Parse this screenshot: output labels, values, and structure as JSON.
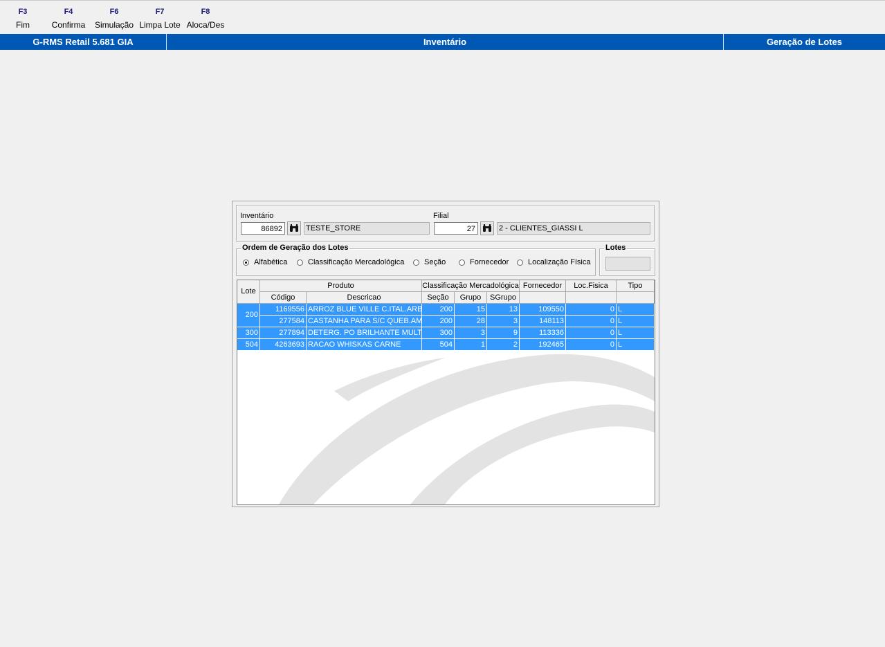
{
  "toolbar": [
    {
      "key": "F3",
      "label": "Fim"
    },
    {
      "key": "F4",
      "label": "Confirma"
    },
    {
      "key": "F6",
      "label": "Simulação"
    },
    {
      "key": "F7",
      "label": "Limpa Lote"
    },
    {
      "key": "F8",
      "label": "Aloca/Des"
    }
  ],
  "titlebar": {
    "app": "G-RMS Retail 5.681 GIA",
    "module": "Inventário",
    "screen": "Geração de Lotes"
  },
  "filters": {
    "inventario_label": "Inventário",
    "inventario_value": "86892",
    "inventario_desc": "TESTE_STORE",
    "filial_label": "Filial",
    "filial_value": "27",
    "filial_desc": "2 - CLIENTES_GIASSI L"
  },
  "ordem": {
    "title": "Ordem de Geração dos Lotes",
    "options": [
      "Alfabética",
      "Classificação Mercadológica",
      "Seção",
      "Fornecedor",
      "Localização Física"
    ],
    "selected": "Alfabética"
  },
  "lotes": {
    "title": "Lotes",
    "value": ""
  },
  "grid": {
    "headers": {
      "lote": "Lote",
      "produto": "Produto",
      "codigo": "Código",
      "descricao": "Descricao",
      "classificacao": "Classificação Mercadológica",
      "secao": "Seção",
      "grupo": "Grupo",
      "sgrupo": "SGrupo",
      "fornecedor": "Fornecedor",
      "locfisica": "Loc.Fisica",
      "tipo": "Tipo"
    },
    "rows": [
      {
        "lote": "200",
        "codigo": "1169556",
        "descricao": "ARROZ BLUE VILLE C.ITAL.ARBO",
        "secao": "200",
        "grupo": "15",
        "sgrupo": "13",
        "fornecedor": "109550",
        "locfisica": "0",
        "tipo": "L"
      },
      {
        "lote": "200",
        "codigo": "277584",
        "descricao": "CASTANHA PARA S/C QUEB.AMA",
        "secao": "200",
        "grupo": "28",
        "sgrupo": "3",
        "fornecedor": "148113",
        "locfisica": "0",
        "tipo": "L"
      },
      {
        "lote": "300",
        "codigo": "277894",
        "descricao": "DETERG. PO BRILHANTE MULTI TI",
        "secao": "300",
        "grupo": "3",
        "sgrupo": "9",
        "fornecedor": "113336",
        "locfisica": "0",
        "tipo": "L"
      },
      {
        "lote": "504",
        "codigo": "4263693",
        "descricao": "RACAO WHISKAS CARNE",
        "secao": "504",
        "grupo": "1",
        "sgrupo": "2",
        "fornecedor": "192465",
        "locfisica": "0",
        "tipo": "L"
      }
    ]
  },
  "icons": {
    "binoculars": "binoculars-icon"
  },
  "colors": {
    "titlebar": "#0058b4",
    "selection": "#3399ff",
    "background": "#f0f0f0"
  }
}
